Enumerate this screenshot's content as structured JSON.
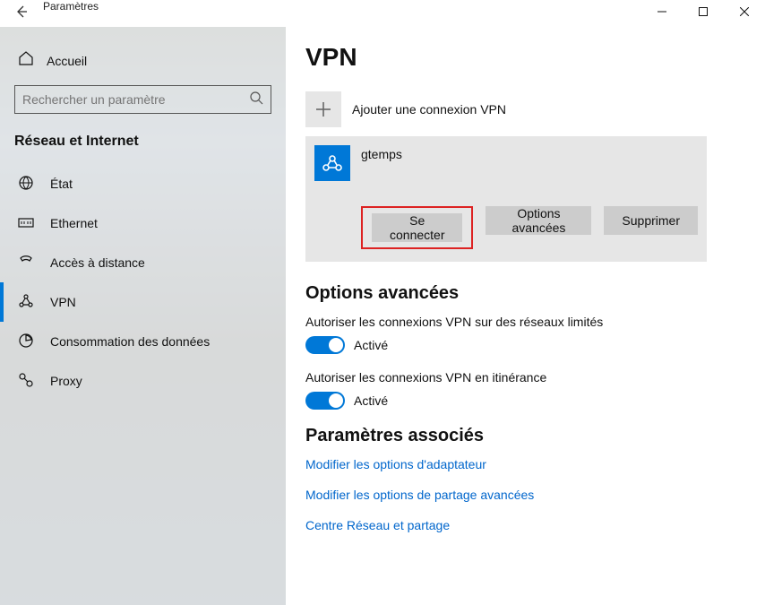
{
  "titlebar": {
    "title": "Paramètres"
  },
  "sidebar": {
    "home_label": "Accueil",
    "search_placeholder": "Rechercher un paramètre",
    "category": "Réseau et Internet",
    "items": [
      {
        "icon": "status-icon",
        "label": "État"
      },
      {
        "icon": "ethernet-icon",
        "label": "Ethernet"
      },
      {
        "icon": "dialup-icon",
        "label": "Accès à distance"
      },
      {
        "icon": "vpn-icon",
        "label": "VPN"
      },
      {
        "icon": "data-icon",
        "label": "Consommation des données"
      },
      {
        "icon": "proxy-icon",
        "label": "Proxy"
      }
    ],
    "selected_index": 3
  },
  "main": {
    "page_title": "VPN",
    "add_vpn_label": "Ajouter une connexion VPN",
    "connection": {
      "name": "gtemps",
      "buttons": {
        "connect": "Se connecter",
        "advanced": "Options avancées",
        "delete": "Supprimer"
      }
    },
    "advanced_title": "Options avancées",
    "toggles": [
      {
        "label": "Autoriser les connexions VPN sur des réseaux limités",
        "state_text": "Activé",
        "on": true
      },
      {
        "label": "Autoriser les connexions VPN en itinérance",
        "state_text": "Activé",
        "on": true
      }
    ],
    "related_title": "Paramètres associés",
    "links": [
      "Modifier les options d'adaptateur",
      "Modifier les options de partage avancées",
      "Centre Réseau et partage"
    ]
  },
  "colors": {
    "accent": "#0078d7",
    "link": "#0066cc",
    "highlight": "#d22"
  }
}
